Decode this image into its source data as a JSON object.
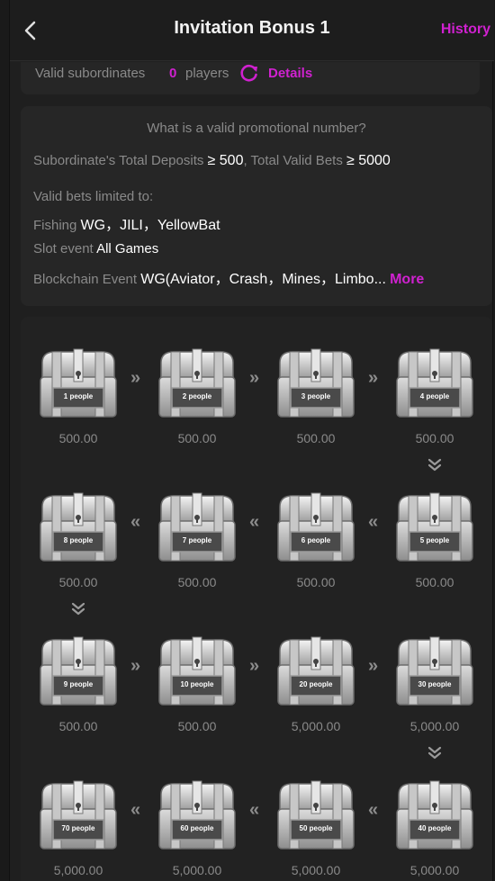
{
  "header": {
    "title": "Invitation Bonus 1",
    "history_label": "History"
  },
  "valid_subordinates": {
    "label": "Valid subordinates",
    "count": "0",
    "unit": "players",
    "details_label": "Details"
  },
  "rules": {
    "question": "What is a valid promotional number?",
    "deposits_label": "Subordinate's Total Deposits",
    "deposits_value": "≥ 500",
    "bets_label": "Total Valid Bets",
    "bets_value": "≥ 5000",
    "limited_label": "Valid bets limited to:",
    "fishing_label": "Fishing",
    "fishing_value": "WG，JILI，YellowBat",
    "slot_label": "Slot event",
    "slot_value": "All Games",
    "blockchain_label": "Blockchain Event",
    "blockchain_value": "WG(Aviator，Crash，Mines，Limbo...",
    "more_label": "More"
  },
  "chests": [
    {
      "people": "1 people",
      "amount": "500.00"
    },
    {
      "people": "2 people",
      "amount": "500.00"
    },
    {
      "people": "3 people",
      "amount": "500.00"
    },
    {
      "people": "4 people",
      "amount": "500.00"
    },
    {
      "people": "5 people",
      "amount": "500.00"
    },
    {
      "people": "6 people",
      "amount": "500.00"
    },
    {
      "people": "7 people",
      "amount": "500.00"
    },
    {
      "people": "8 people",
      "amount": "500.00"
    },
    {
      "people": "9 people",
      "amount": "500.00"
    },
    {
      "people": "10 people",
      "amount": "500.00"
    },
    {
      "people": "20 people",
      "amount": "5,000.00"
    },
    {
      "people": "30 people",
      "amount": "5,000.00"
    },
    {
      "people": "40 people",
      "amount": "5,000.00"
    },
    {
      "people": "50 people",
      "amount": "5,000.00"
    },
    {
      "people": "60 people",
      "amount": "5,000.00"
    },
    {
      "people": "70 people",
      "amount": "5,000.00"
    }
  ],
  "colors": {
    "accent": "#d021d0",
    "muted_text": "#8a8a8a",
    "background": "#1f1f1f"
  },
  "icons": {
    "back": "chevron-left-icon",
    "refresh": "refresh-icon",
    "chest": "treasure-chest-icon",
    "right_arrow": "double-chevron-right-icon",
    "left_arrow": "double-chevron-left-icon",
    "down_arrow": "double-chevron-down-icon"
  }
}
